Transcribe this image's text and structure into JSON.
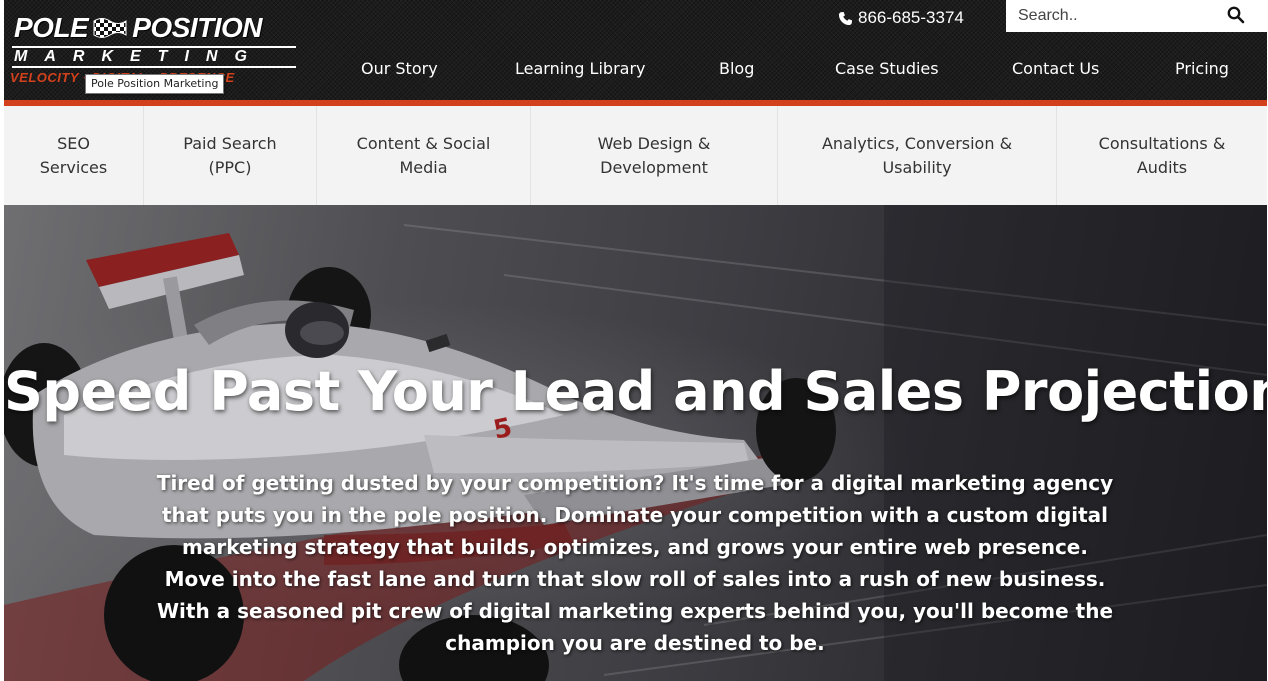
{
  "brand": {
    "logo_line1_left": "POLE",
    "logo_line1_right": "POSITION",
    "logo_line2": "MARKETING",
    "logo_line3": "VELOCITY · DIGITAL · PRESENCE",
    "tooltip": "Pole Position Marketing",
    "accent_color": "#d2411c"
  },
  "header": {
    "phone": "866-685-3374",
    "search_placeholder": "Search..",
    "nav": [
      {
        "label": "Our Story"
      },
      {
        "label": "Learning Library"
      },
      {
        "label": "Blog"
      },
      {
        "label": "Case Studies"
      },
      {
        "label": "Contact Us"
      },
      {
        "label": "Pricing"
      }
    ]
  },
  "services": [
    {
      "line1": "SEO",
      "line2": "Services"
    },
    {
      "line1": "Paid Search",
      "line2": "(PPC)"
    },
    {
      "line1": "Content & Social",
      "line2": "Media"
    },
    {
      "line1": "Web Design &",
      "line2": "Development"
    },
    {
      "line1": "Analytics, Conversion &",
      "line2": "Usability"
    },
    {
      "line1": "Consultations &",
      "line2": "Audits"
    }
  ],
  "hero": {
    "title": "Speed Past Your Lead and Sales Projections",
    "body": "Tired of getting dusted by your competition? It's time for a digital marketing agency that puts you in the pole position. Dominate your competition with a custom digital marketing strategy that builds, optimizes, and grows your entire web presence. Move into the fast lane and turn that slow roll of sales into a rush of new business. With a seasoned pit crew of digital marketing experts behind you, you'll become the champion you are destined to be.",
    "car_number": "5"
  }
}
